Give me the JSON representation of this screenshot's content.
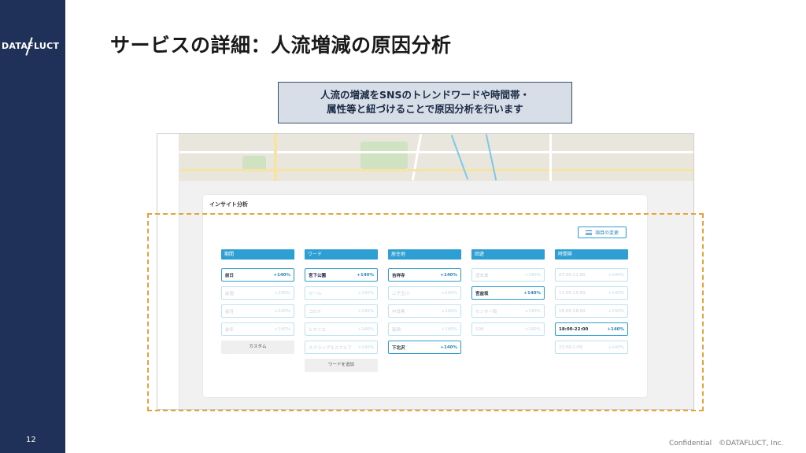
{
  "slide": {
    "page_number": "12",
    "title": "サービスの詳細：人流増減の原因分析",
    "callout_line1": "人流の増減をSNSのトレンドワードや時間帯・",
    "callout_line2": "属性等と紐づけることで原因分析を行います",
    "footer": "Confidential　©DATAFLUCT, Inc."
  },
  "logo": {
    "text": "DATAFLUCT"
  },
  "panel": {
    "title": "インサイト分析",
    "change_button": "項目の変更",
    "columns": [
      {
        "header": "期間",
        "rows": [
          {
            "label": "前日",
            "pct": "+140%",
            "selected": true
          },
          {
            "label": "前週",
            "pct": "+140%",
            "selected": false
          },
          {
            "label": "前月",
            "pct": "+140%",
            "selected": false
          },
          {
            "label": "前年",
            "pct": "+140%",
            "selected": false
          }
        ],
        "extra": "カスタム"
      },
      {
        "header": "ワード",
        "rows": [
          {
            "label": "宮下公園",
            "pct": "+140%",
            "selected": true
          },
          {
            "label": "セール",
            "pct": "+140%",
            "selected": false
          },
          {
            "label": "コロナ",
            "pct": "+140%",
            "selected": false
          },
          {
            "label": "ヒカリエ",
            "pct": "+140%",
            "selected": false
          },
          {
            "label": "スクランブルスクエア",
            "pct": "+140%",
            "selected": false
          }
        ],
        "extra": "ワードを追加"
      },
      {
        "header": "居住地",
        "rows": [
          {
            "label": "吉祥寺",
            "pct": "+140%",
            "selected": true
          },
          {
            "label": "二子玉川",
            "pct": "+140%",
            "selected": false
          },
          {
            "label": "中目黒",
            "pct": "+140%",
            "selected": false
          },
          {
            "label": "新宿",
            "pct": "+140%",
            "selected": false
          },
          {
            "label": "下北沢",
            "pct": "+140%",
            "selected": true
          }
        ]
      },
      {
        "header": "回遊",
        "rows": [
          {
            "label": "道玄坂",
            "pct": "+140%",
            "selected": false
          },
          {
            "label": "宮益坂",
            "pct": "+140%",
            "selected": true
          },
          {
            "label": "センター街",
            "pct": "+140%",
            "selected": false
          },
          {
            "label": "109",
            "pct": "+140%",
            "selected": false
          }
        ]
      },
      {
        "header": "時間帯",
        "rows": [
          {
            "label": "07:00-11:00",
            "pct": "+140%",
            "selected": false
          },
          {
            "label": "11:00-15:00",
            "pct": "+140%",
            "selected": false
          },
          {
            "label": "15:00-18:00",
            "pct": "+140%",
            "selected": false
          },
          {
            "label": "18:00-22:00",
            "pct": "+140%",
            "selected": true
          },
          {
            "label": "21:00-1:00",
            "pct": "+140%",
            "selected": false
          }
        ]
      }
    ]
  },
  "colors": {
    "sidebar": "#1f3158",
    "accent": "#2e9fd3",
    "dashed_highlight": "#e8a23a",
    "callout_bg": "#d7dee8"
  }
}
